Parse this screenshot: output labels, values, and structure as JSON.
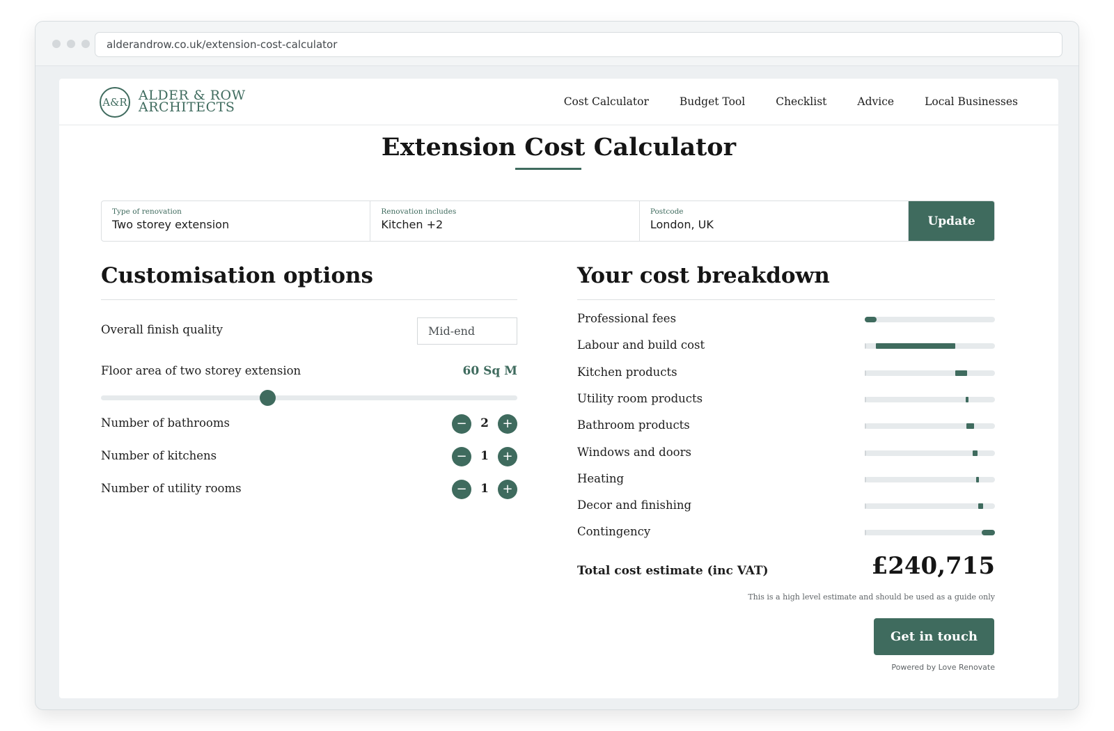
{
  "browser": {
    "url": "alderandrow.co.uk/extension-cost-calculator"
  },
  "brand": {
    "mark": "A&R",
    "line1": "ALDER & ROW",
    "line2": "ARCHITECTS",
    "color": "#3f6b5e"
  },
  "nav": [
    "Cost Calculator",
    "Budget Tool",
    "Checklist",
    "Advice",
    "Local Businesses"
  ],
  "page_title": "Extension Cost Calculator",
  "form": {
    "fields": [
      {
        "label": "Type of renovation",
        "value": "Two storey extension"
      },
      {
        "label": "Renovation includes",
        "value": "Kitchen +2"
      },
      {
        "label": "Postcode",
        "value": "London, UK"
      }
    ],
    "update_label": "Update"
  },
  "customisation": {
    "title": "Customisation options",
    "finish_label": "Overall finish quality",
    "finish_value": "Mid-end",
    "area_label": "Floor area of two storey extension",
    "area_value": "60 Sq M",
    "area_slider_fraction": 0.4,
    "steppers": [
      {
        "label": "Number of bathrooms",
        "value": "2"
      },
      {
        "label": "Number of kitchens",
        "value": "1"
      },
      {
        "label": "Number of utility rooms",
        "value": "1"
      }
    ],
    "minus_glyph": "−",
    "plus_glyph": "+"
  },
  "breakdown": {
    "title": "Your cost breakdown",
    "items": [
      {
        "label": "Professional fees",
        "start": 0.0,
        "share": 0.09
      },
      {
        "label": "Labour and build cost",
        "start": 0.085,
        "share": 0.61
      },
      {
        "label": "Kitchen products",
        "start": 0.695,
        "share": 0.09
      },
      {
        "label": "Utility room products",
        "start": 0.775,
        "share": 0.02
      },
      {
        "label": "Bathroom products",
        "start": 0.78,
        "share": 0.06
      },
      {
        "label": "Windows and doors",
        "start": 0.83,
        "share": 0.035
      },
      {
        "label": "Heating",
        "start": 0.855,
        "share": 0.02
      },
      {
        "label": "Decor and finishing",
        "start": 0.87,
        "share": 0.04
      },
      {
        "label": "Contingency",
        "start": 0.9,
        "share": 0.1
      }
    ],
    "total_label": "Total cost estimate (inc VAT)",
    "total_value": "£240,715",
    "disclaimer": "This is a high level estimate and should be used as a guide only",
    "cta_label": "Get in touch",
    "powered_by": "Powered by Love Renovate"
  }
}
